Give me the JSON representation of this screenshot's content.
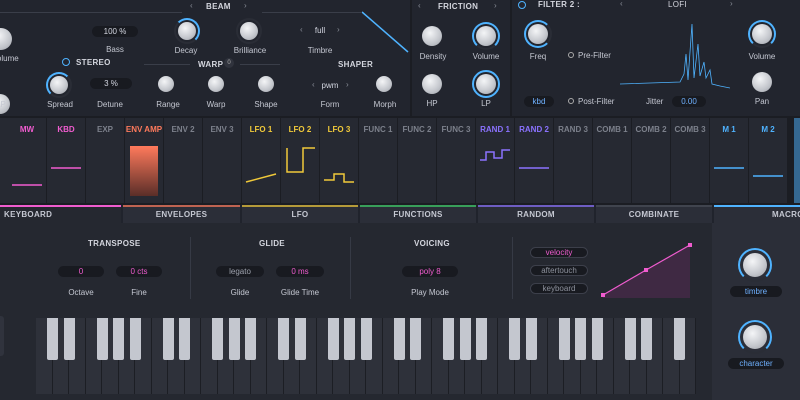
{
  "top": {
    "bass_value": "100 %",
    "bass_label": "Bass",
    "volume_label": "Volume",
    "lp_label": "LP",
    "stereo_header": "STEREO",
    "spread_label": "Spread",
    "detune_value": "3 %",
    "detune_label": "Detune",
    "beam_header": "BEAM",
    "decay_label": "Decay",
    "brilliance_label": "Brilliance",
    "timbre_value": "full",
    "timbre_label": "Timbre",
    "warp_header": "WARP",
    "warp_badge": "0",
    "range_label": "Range",
    "warp_label": "Warp",
    "shape_label": "Shape",
    "shaper_header": "SHAPER",
    "form_value": "pwm",
    "form_label": "Form",
    "morph_label": "Morph",
    "friction_header": "FRICTION",
    "density_label": "Density",
    "friction_volume_label": "Volume",
    "hp_label": "HP",
    "friction_lp_label": "LP",
    "filter2_header": "FILTER 2 :",
    "filter2_type": "LOFI",
    "freq_label": "Freq",
    "prefilter_label": "Pre-Filter",
    "kbd_value": "kbd",
    "postfilter_label": "Post-Filter",
    "jitter_label": "Jitter",
    "jitter_value": "0.00",
    "filter_volume_label": "Volume",
    "pan_label": "Pan"
  },
  "modulators": [
    {
      "label": "MW",
      "color": "#f05ccf"
    },
    {
      "label": "KBD",
      "color": "#f05ccf"
    },
    {
      "label": "EXP",
      "color": "#7c808b"
    },
    {
      "label": "ENV AMP",
      "color": "#ff7a5c"
    },
    {
      "label": "ENV 2",
      "color": "#7c808b"
    },
    {
      "label": "ENV 3",
      "color": "#7c808b"
    },
    {
      "label": "LFO 1",
      "color": "#f0c93a"
    },
    {
      "label": "LFO 2",
      "color": "#f0c93a"
    },
    {
      "label": "LFO 3",
      "color": "#f0c93a"
    },
    {
      "label": "FUNC 1",
      "color": "#7c808b"
    },
    {
      "label": "FUNC 2",
      "color": "#7c808b"
    },
    {
      "label": "FUNC 3",
      "color": "#7c808b"
    },
    {
      "label": "RAND 1",
      "color": "#8b72ff"
    },
    {
      "label": "RAND 2",
      "color": "#8b72ff"
    },
    {
      "label": "RAND 3",
      "color": "#7c808b"
    },
    {
      "label": "COMB 1",
      "color": "#7c808b"
    },
    {
      "label": "COMB 2",
      "color": "#7c808b"
    },
    {
      "label": "COMB 3",
      "color": "#7c808b"
    },
    {
      "label": "M 1",
      "color": "#4fb3ff"
    },
    {
      "label": "M 2",
      "color": "#4fb3ff"
    }
  ],
  "tabs": [
    {
      "label": "KEYBOARD",
      "color": "#f05ccf"
    },
    {
      "label": "ENVELOPES",
      "color": "#ff7a5c"
    },
    {
      "label": "LFO",
      "color": "#f0c93a"
    },
    {
      "label": "FUNCTIONS",
      "color": "#3fd06a"
    },
    {
      "label": "RANDOM",
      "color": "#8b72ff"
    },
    {
      "label": "COMBINATE",
      "color": "#4a4e59"
    },
    {
      "label": "MACRO",
      "color": "#4fb3ff"
    }
  ],
  "keyboard": {
    "transpose_header": "TRANSPOSE",
    "octave_value": "0",
    "octave_label": "Octave",
    "fine_value": "0 cts",
    "fine_label": "Fine",
    "glide_header": "GLIDE",
    "glide_value": "legato",
    "glide_label": "Glide",
    "glide_time_value": "0 ms",
    "glide_time_label": "Glide Time",
    "voicing_header": "VOICING",
    "play_mode_value": "poly 8",
    "play_mode_label": "Play Mode",
    "velocity_label": "velocity",
    "aftertouch_label": "aftertouch",
    "keyboard_label": "keyboard"
  },
  "macro": {
    "timbre_label": "timbre",
    "character_label": "character"
  }
}
